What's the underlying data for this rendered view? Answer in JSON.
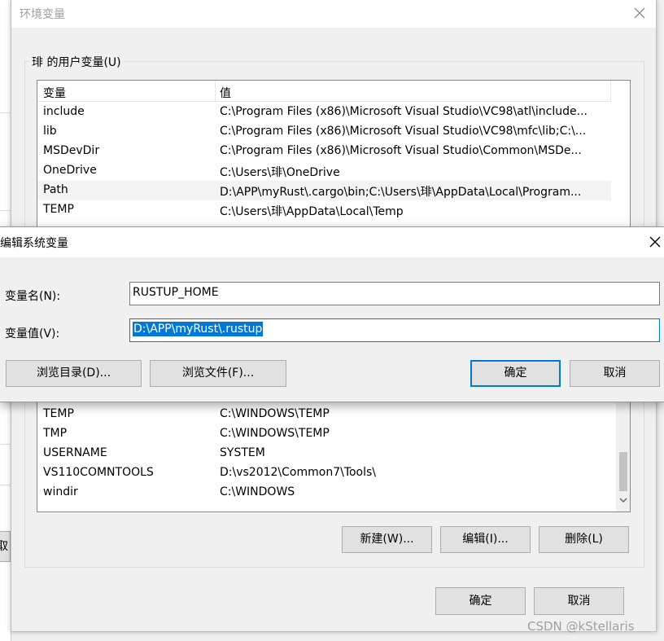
{
  "env_window": {
    "title": "环境变量",
    "user_group_label": "琲 的用户变量(U)",
    "user_list": {
      "columns": [
        "变量",
        "值"
      ],
      "rows": [
        {
          "name": "include",
          "value": "C:\\Program Files (x86)\\Microsoft Visual Studio\\VC98\\atl\\include..."
        },
        {
          "name": "lib",
          "value": "C:\\Program Files (x86)\\Microsoft Visual Studio\\VC98\\mfc\\lib;C:\\..."
        },
        {
          "name": "MSDevDir",
          "value": "C:\\Program Files (x86)\\Microsoft Visual Studio\\Common\\MSDe..."
        },
        {
          "name": "OneDrive",
          "value": "C:\\Users\\琲\\OneDrive"
        },
        {
          "name": "Path",
          "value": "D:\\APP\\myRust\\.cargo\\bin;C:\\Users\\琲\\AppData\\Local\\Program..."
        },
        {
          "name": "TEMP",
          "value": "C:\\Users\\琲\\AppData\\Local\\Temp"
        }
      ]
    },
    "system_list": {
      "rows": [
        {
          "name": "TEMP",
          "value": "C:\\WINDOWS\\TEMP"
        },
        {
          "name": "TMP",
          "value": "C:\\WINDOWS\\TEMP"
        },
        {
          "name": "USERNAME",
          "value": "SYSTEM"
        },
        {
          "name": "VS110COMNTOOLS",
          "value": "D:\\vs2012\\Common7\\Tools\\"
        },
        {
          "name": "windir",
          "value": "C:\\WINDOWS"
        }
      ]
    },
    "buttons": {
      "new": "新建(W)...",
      "edit": "编辑(I)...",
      "delete": "删除(L)",
      "ok": "确定",
      "cancel": "取消"
    },
    "bg_cancel_fragment": "取"
  },
  "edit_dialog": {
    "title": "编辑系统变量",
    "name_label": "变量名(N):",
    "name_value": "RUSTUP_HOME",
    "value_label": "变量值(V):",
    "value_value": "D:\\APP\\myRust\\.rustup",
    "browse_dir": "浏览目录(D)...",
    "browse_file": "浏览文件(F)...",
    "ok": "确定",
    "cancel": "取消"
  },
  "watermark": "CSDN @kStellaris",
  "icons": {
    "close": "close-icon",
    "scroll_down": "chevron-down-icon"
  },
  "colors": {
    "accent": "#0078d7",
    "window_bg": "#f0f0f0",
    "button_bg": "#e1e1e1"
  }
}
